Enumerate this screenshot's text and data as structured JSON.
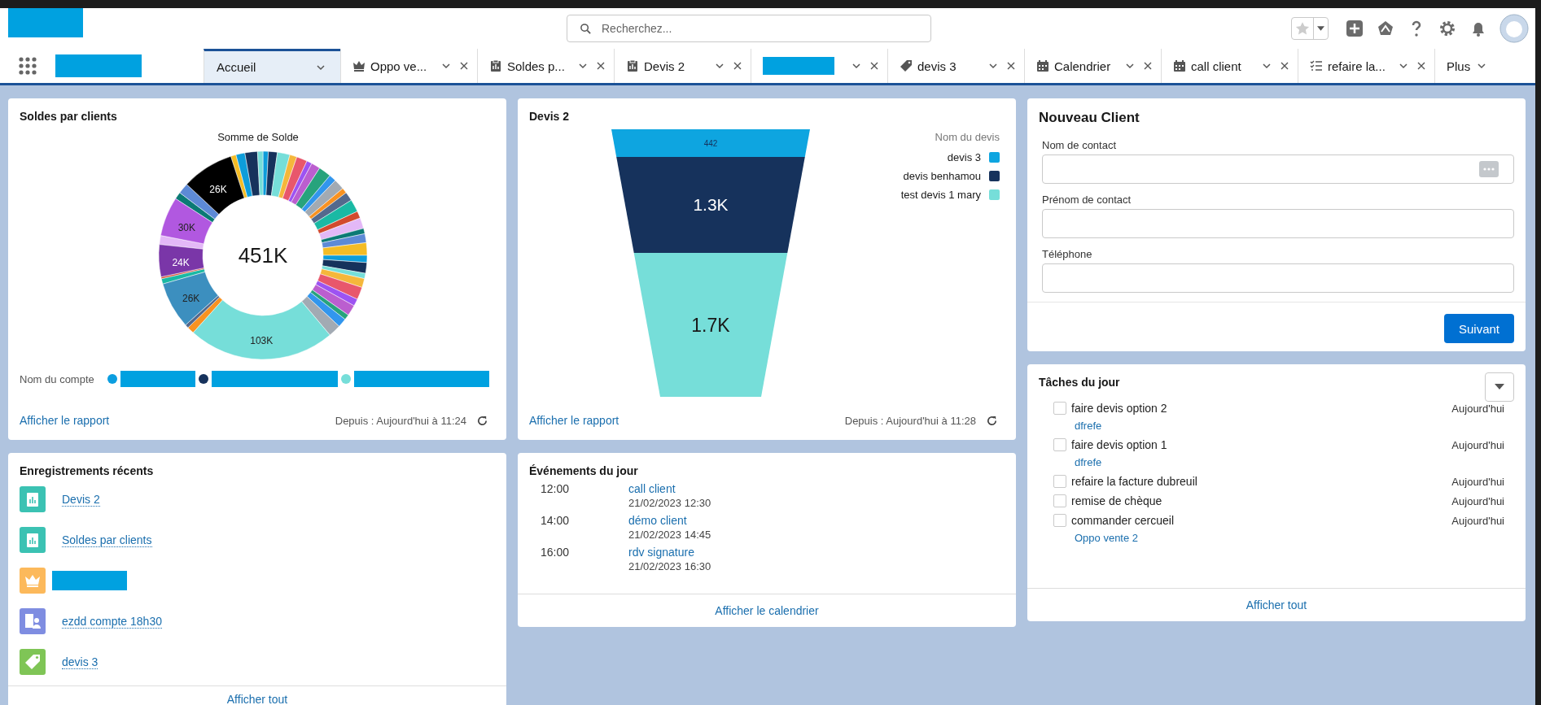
{
  "header": {
    "search": {
      "placeholder": "Recherchez..."
    }
  },
  "tabs": [
    {
      "kind": "home",
      "label": "Accueil",
      "selected": true,
      "closable": false
    },
    {
      "kind": "crown",
      "label": "Oppo ve...",
      "selected": false,
      "closable": true
    },
    {
      "kind": "report",
      "label": "Soldes p...",
      "selected": false,
      "closable": true
    },
    {
      "kind": "report",
      "label": "Devis 2",
      "selected": false,
      "closable": true
    },
    {
      "kind": "redacted",
      "selected": false,
      "closable": true
    },
    {
      "kind": "tag",
      "label": "devis 3",
      "selected": false,
      "closable": true
    },
    {
      "kind": "calendar",
      "label": "Calendrier",
      "selected": false,
      "closable": true
    },
    {
      "kind": "calendar",
      "label": "call client",
      "selected": false,
      "closable": true
    },
    {
      "kind": "tasks",
      "label": "refaire la...",
      "selected": false,
      "closable": true
    }
  ],
  "more_tab": {
    "label": "Plus"
  },
  "soldes": {
    "title": "Soldes par clients",
    "chart_title": "Somme de Solde",
    "total": "451K",
    "slice_labels": [
      "103K",
      "26K",
      "24K",
      "30K",
      "26K"
    ],
    "legend_title": "Nom du compte",
    "legend": [
      {
        "color": "#0b9ee0"
      },
      {
        "color": "#16325c"
      },
      {
        "color": "#76ded9"
      }
    ],
    "link": "Afficher le rapport",
    "since": "Depuis : Aujourd'hui à 11:24"
  },
  "devis": {
    "title": "Devis 2",
    "legend_title": "Nom du devis",
    "segments": [
      {
        "label": "442",
        "name": "devis 3",
        "color": "#0ea5e0"
      },
      {
        "label": "1.3K",
        "name": "devis benhamou",
        "color": "#16325c"
      },
      {
        "label": "1.7K",
        "name": "test devis 1 mary",
        "color": "#76ded9"
      }
    ],
    "link": "Afficher le rapport",
    "since": "Depuis : Aujourd'hui à 11:28"
  },
  "nouveau_client": {
    "title": "Nouveau Client",
    "fields": [
      {
        "label": "Nom de contact",
        "kind": "lookup"
      },
      {
        "label": "Prénom de contact",
        "kind": "text"
      },
      {
        "label": "Téléphone",
        "kind": "text"
      }
    ],
    "button": "Suivant"
  },
  "taches": {
    "title": "Tâches du jour",
    "items": [
      {
        "label": "faire devis option 2",
        "checked": false,
        "date": "Aujourd'hui",
        "related": "dfrefe"
      },
      {
        "label": "faire devis option 1",
        "checked": false,
        "date": "Aujourd'hui",
        "related": "dfrefe"
      },
      {
        "label": "refaire la facture dubreuil",
        "checked": false,
        "date": "Aujourd'hui"
      },
      {
        "label": "remise de chèque",
        "checked": false,
        "date": "Aujourd'hui"
      },
      {
        "label": "commander cercueil",
        "checked": false,
        "date": "Aujourd'hui",
        "related": "Oppo vente 2"
      }
    ],
    "footer": "Afficher tout"
  },
  "recents": {
    "title": "Enregistrements récents",
    "items": [
      {
        "kind": "report",
        "label": "Devis 2"
      },
      {
        "kind": "report",
        "label": "Soldes par clients"
      },
      {
        "kind": "crown"
      },
      {
        "kind": "account",
        "label": "ezdd compte 18h30"
      },
      {
        "kind": "tag",
        "label": "devis 3"
      }
    ],
    "footer": "Afficher tout"
  },
  "evenements": {
    "title": "Événements du jour",
    "items": [
      {
        "time": "12:00",
        "title": "call client",
        "date": "21/02/2023 12:30"
      },
      {
        "time": "14:00",
        "title": "démo client",
        "date": "21/02/2023 14:45"
      },
      {
        "time": "16:00",
        "title": "rdv signature",
        "date": "21/02/2023 16:30"
      }
    ],
    "footer": "Afficher le calendrier"
  }
}
